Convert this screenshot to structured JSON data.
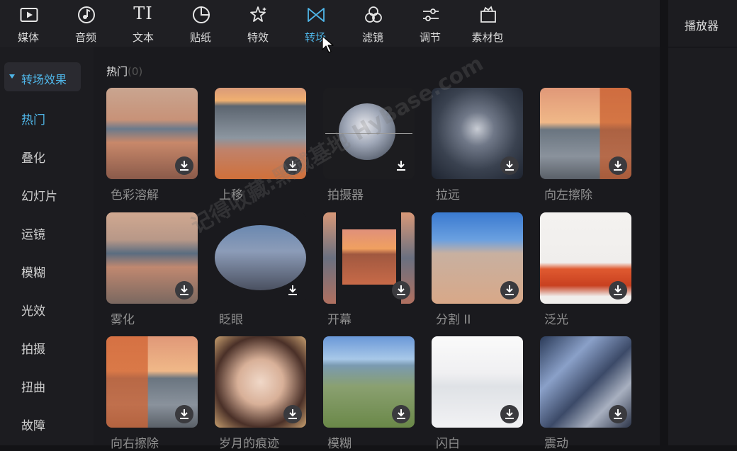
{
  "toolbar": {
    "tools": [
      {
        "label": "媒体",
        "icon": "media-play-icon"
      },
      {
        "label": "音频",
        "icon": "music-note-icon"
      },
      {
        "label": "文本",
        "icon": "text-ti-icon",
        "glyph": "TI"
      },
      {
        "label": "贴纸",
        "icon": "sticker-icon"
      },
      {
        "label": "特效",
        "icon": "sparkle-star-icon"
      },
      {
        "label": "转场",
        "icon": "transition-bowtie-icon",
        "active": true
      },
      {
        "label": "滤镜",
        "icon": "filter-circles-icon"
      },
      {
        "label": "调节",
        "icon": "sliders-icon"
      },
      {
        "label": "素材包",
        "icon": "material-pack-icon"
      }
    ],
    "accent_color": "#4fb6e8"
  },
  "player": {
    "title": "播放器"
  },
  "sidebar": {
    "header": "转场效果",
    "items": [
      "热门",
      "叠化",
      "幻灯片",
      "运镜",
      "模糊",
      "光效",
      "拍摄",
      "扭曲",
      "故障"
    ],
    "active_index": 0
  },
  "content": {
    "section_title": "热门",
    "section_count": "(0)",
    "cards": [
      {
        "label": "色彩溶解"
      },
      {
        "label": "上移"
      },
      {
        "label": "拍摄器"
      },
      {
        "label": "拉远"
      },
      {
        "label": "向左擦除"
      },
      {
        "label": "雾化"
      },
      {
        "label": "眨眼"
      },
      {
        "label": "开幕"
      },
      {
        "label": "分割 II"
      },
      {
        "label": "泛光"
      },
      {
        "label": "向右擦除"
      },
      {
        "label": "岁月的痕迹"
      },
      {
        "label": "模糊"
      },
      {
        "label": "闪白"
      },
      {
        "label": "震动"
      }
    ]
  },
  "watermark": "记得收藏:黑域基地 HyBase.com"
}
